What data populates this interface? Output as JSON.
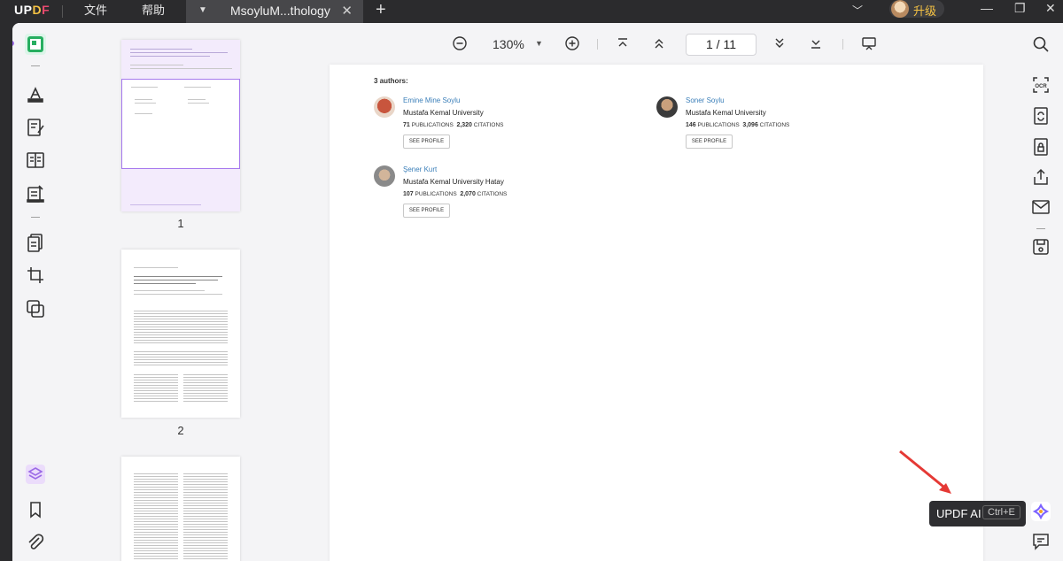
{
  "titlebar": {
    "logo_parts": [
      "UP",
      "D",
      "F"
    ],
    "menu": [
      "文件",
      "帮助"
    ],
    "tab_title": "MsoyluM...thology",
    "upgrade_label": "升级"
  },
  "toolbar": {
    "zoom": "130%",
    "page_current": "1",
    "page_separator": "/",
    "page_total": "11"
  },
  "thumbnails": {
    "pages": [
      "1",
      "2"
    ]
  },
  "document": {
    "authors_title": "3 authors:",
    "authors": [
      {
        "name": "Emine Mine Soylu",
        "institution": "Mustafa Kemal University",
        "pubs": "71",
        "pubs_label": "PUBLICATIONS",
        "cites": "2,320",
        "cites_label": "CITATIONS",
        "button": "SEE PROFILE"
      },
      {
        "name": "Soner Soylu",
        "institution": "Mustafa Kemal University",
        "pubs": "146",
        "pubs_label": "PUBLICATIONS",
        "cites": "3,096",
        "cites_label": "CITATIONS",
        "button": "SEE PROFILE"
      },
      {
        "name": "Şener Kurt",
        "institution": "Mustafa Kemal University Hatay",
        "pubs": "107",
        "pubs_label": "PUBLICATIONS",
        "cites": "2,070",
        "cites_label": "CITATIONS",
        "button": "SEE PROFILE"
      }
    ]
  },
  "tooltip": {
    "label": "UPDF AI",
    "shortcut": "Ctrl+E"
  },
  "colors": {
    "accent": "#a679ee",
    "active_tool": "#27ae60",
    "arrow": "#e53935",
    "link": "#3b7fb9"
  }
}
